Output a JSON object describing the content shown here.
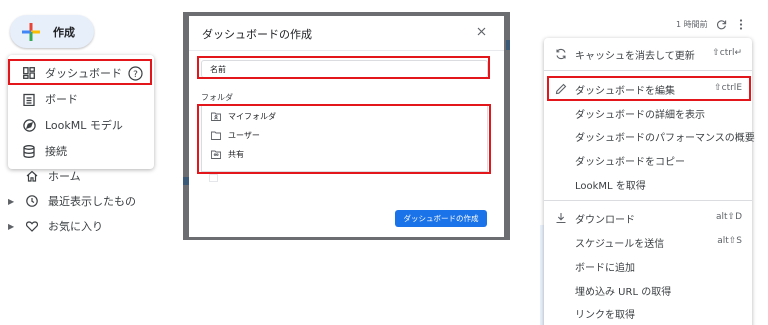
{
  "create_button": {
    "label": "作成"
  },
  "create_menu": {
    "items": [
      {
        "label": "ダッシュボード",
        "icon": "dashboard-icon"
      },
      {
        "label": "ボード",
        "icon": "board-icon"
      },
      {
        "label": "LookML モデル",
        "icon": "explore-icon"
      },
      {
        "label": "接続",
        "icon": "database-icon"
      }
    ]
  },
  "sidebar": {
    "items": [
      {
        "label": "ホーム",
        "icon": "home-icon"
      },
      {
        "label": "最近表示したもの",
        "icon": "clock-icon"
      },
      {
        "label": "お気に入り",
        "icon": "heart-icon"
      }
    ]
  },
  "dialog": {
    "title": "ダッシュボードの作成",
    "name_placeholder": "名前",
    "folder_label": "フォルダ",
    "folders": [
      {
        "label": "マイフォルダ",
        "icon": "personal-folder-icon"
      },
      {
        "label": "ユーザー",
        "icon": "folder-icon"
      },
      {
        "label": "共有",
        "icon": "shared-folder-icon"
      }
    ],
    "create_button": "ダッシュボードの作成"
  },
  "header_right": {
    "last_run": "1 時間前"
  },
  "right_menu": {
    "items": [
      {
        "label": "キャッシュを消去して更新",
        "shortcut": "⇧ctrl↵",
        "icon": "refresh-icon"
      },
      {
        "label": "ダッシュボードを編集",
        "shortcut": "⇧ctrlE",
        "icon": "pencil-icon"
      },
      {
        "label": "ダッシュボードの詳細を表示",
        "shortcut": ""
      },
      {
        "label": "ダッシュボードのパフォーマンスの概要",
        "shortcut": ""
      },
      {
        "label": "ダッシュボードをコピー",
        "shortcut": ""
      },
      {
        "label": "LookML を取得",
        "shortcut": ""
      },
      {
        "label": "ダウンロード",
        "shortcut": "alt⇧D",
        "icon": "download-icon"
      },
      {
        "label": "スケジュールを送信",
        "shortcut": "alt⇧S"
      },
      {
        "label": "ボードに追加",
        "shortcut": ""
      },
      {
        "label": "埋め込み URL の取得",
        "shortcut": ""
      },
      {
        "label": "リンクを取得",
        "shortcut": ""
      }
    ]
  },
  "colors": {
    "highlight": "#e3161b",
    "primary_button": "#1a73e8",
    "create_button_bg": "#e7effb"
  }
}
